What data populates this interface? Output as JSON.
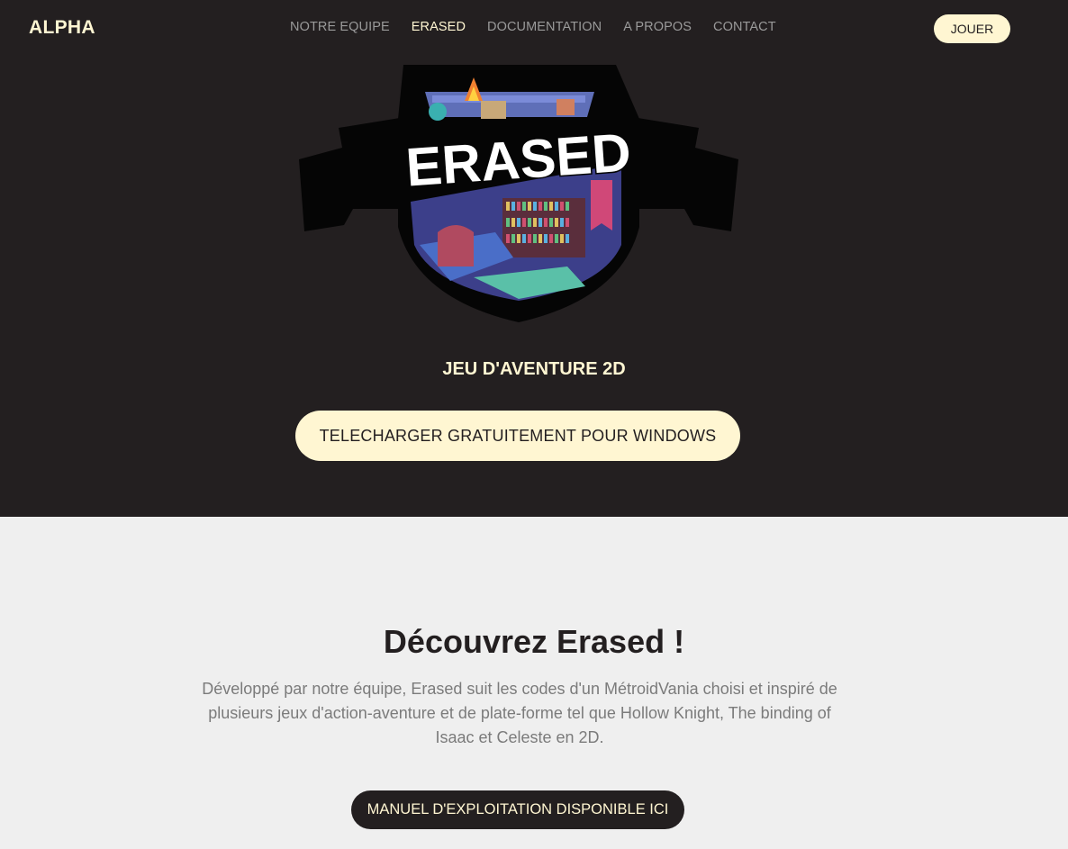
{
  "header": {
    "brand": "ALPHA",
    "nav": [
      {
        "label": "NOTRE EQUIPE",
        "active": false
      },
      {
        "label": "ERASED",
        "active": true
      },
      {
        "label": "DOCUMENTATION",
        "active": false
      },
      {
        "label": "A PROPOS",
        "active": false
      },
      {
        "label": "CONTACT",
        "active": false
      }
    ],
    "play_label": "JOUER"
  },
  "hero": {
    "logo_text": "ERASED",
    "subtitle": "JEU D'AVENTURE 2D",
    "download_label": "TELECHARGER GRATUITEMENT POUR WINDOWS"
  },
  "about": {
    "title": "Découvrez Erased !",
    "description": "Développé par notre équipe, Erased suit les codes d'un MétroidVania choisi et inspiré de plusieurs jeux d'action-aventure et de plate-forme tel que Hollow Knight, The binding of Isaac et Celeste en 2D.",
    "manual_label": "MANUEL D'EXPLOITATION DISPONIBLE ICI"
  },
  "colors": {
    "dark": "#231f20",
    "cream": "#fff6d2",
    "light_bg": "#efefef",
    "muted_text": "#7b7b7b"
  }
}
